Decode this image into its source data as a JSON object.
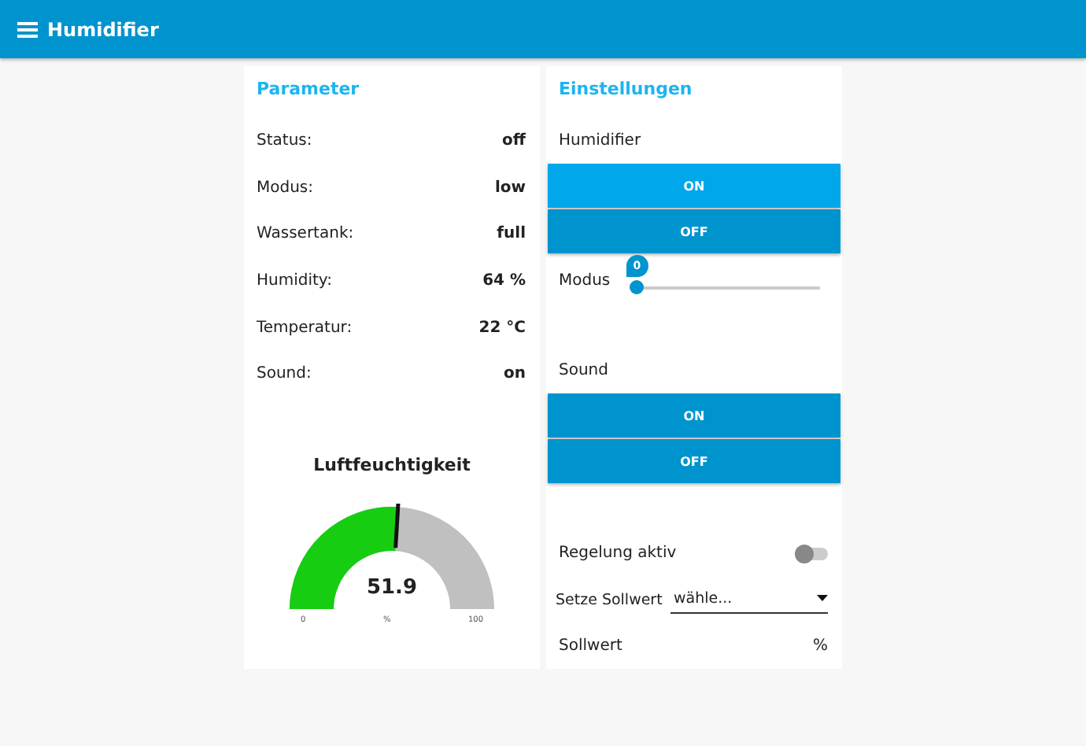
{
  "header": {
    "title": "Humidifier"
  },
  "parameter": {
    "title": "Parameter",
    "rows": [
      {
        "label": "Status:",
        "value": "off"
      },
      {
        "label": "Modus:",
        "value": "low"
      },
      {
        "label": "Wassertank:",
        "value": "full"
      },
      {
        "label": "Humidity:",
        "value": "64 %"
      },
      {
        "label": "Temperatur:",
        "value": "22 °C"
      },
      {
        "label": "Sound:",
        "value": "on"
      }
    ],
    "gauge": {
      "title": "Luftfeuchtigkeit",
      "value": "51.9",
      "min": "0",
      "max": "100",
      "unit": "%"
    }
  },
  "settings": {
    "title": "Einstellungen",
    "humidifier": {
      "label": "Humidifier",
      "buttons": [
        {
          "label": "ON",
          "hovered": true
        },
        {
          "label": "OFF",
          "hovered": false
        }
      ]
    },
    "modus": {
      "label": "Modus",
      "level": 0,
      "reading": "0"
    },
    "sound": {
      "label": "Sound",
      "buttons": [
        {
          "label": "ON",
          "hovered": false
        },
        {
          "label": "OFF",
          "hovered": false
        }
      ]
    },
    "regelung": {
      "label": "Regelung aktiv",
      "on": false
    },
    "sollwert_select": {
      "label": "Setze Sollwert",
      "value": "wähle..."
    },
    "sollwert": {
      "label": "Sollwert",
      "value": "%"
    }
  }
}
